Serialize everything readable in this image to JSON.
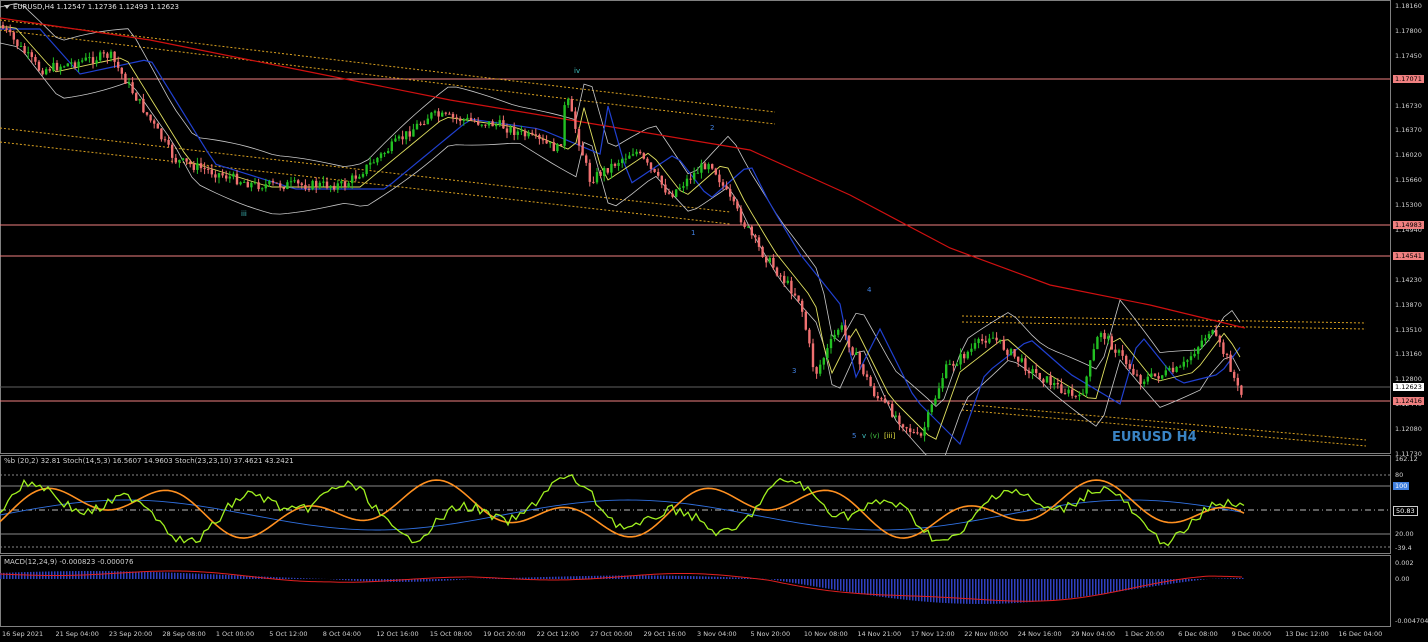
{
  "header": {
    "symbol": "EURUSD,H4",
    "ohlc": "1.12547 1.12736 1.12493 1.12623"
  },
  "watermark": "EURUSD H4",
  "price_axis": [
    "1.18160",
    "1.17800",
    "1.17450",
    "1.17090",
    "1.16730",
    "1.16370",
    "1.16020",
    "1.15660",
    "1.15300",
    "1.14940",
    "1.14580",
    "1.14230",
    "1.13870",
    "1.13510",
    "1.13160",
    "1.12800",
    "1.12440",
    "1.12080",
    "1.11730"
  ],
  "price_tags": [
    {
      "text": "1.17071",
      "bg": "#f08080",
      "fg": "#000"
    },
    {
      "text": "1.14983",
      "bg": "#f08080",
      "fg": "#000"
    },
    {
      "text": "1.14541",
      "bg": "#f08080",
      "fg": "#000"
    },
    {
      "text": "1.12623",
      "bg": "#ffffff",
      "fg": "#000"
    },
    {
      "text": "1.12416",
      "bg": "#f08080",
      "fg": "#000"
    }
  ],
  "waves": {
    "iii": "iii",
    "iv": "iv",
    "w1": "1",
    "w2": "2",
    "w3": "3",
    "w4": "4",
    "w5": "5",
    "v": "v",
    "vp": "(v)",
    "iiib": "[iii]"
  },
  "stoch_header": "%b (20,2) 32.81  Stoch(14,5,3) 16.5607 14.9603  Stoch(23,23,10) 37.4621 43.2421",
  "stoch_axis": {
    "top": "162.12",
    "l80": "80",
    "l100": "100",
    "cur": "50.83",
    "l20": "20.00",
    "bottom": "-39.4"
  },
  "macd_header": "MACD(12,24,9) -0.000823 -0.000076",
  "macd_axis": {
    "top": "0.002",
    "mid": "0.00",
    "bottom": "-0.004704"
  },
  "time_axis": [
    "16 Sep 2021",
    "21 Sep 04:00",
    "23 Sep 20:00",
    "28 Sep 08:00",
    "1 Oct 00:00",
    "5 Oct 12:00",
    "8 Oct 04:00",
    "12 Oct 16:00",
    "15 Oct 08:00",
    "19 Oct 20:00",
    "22 Oct 12:00",
    "27 Oct 00:00",
    "29 Oct 16:00",
    "3 Nov 04:00",
    "5 Nov 20:00",
    "10 Nov 08:00",
    "14 Nov 21:00",
    "17 Nov 12:00",
    "22 Nov 00:00",
    "24 Nov 16:00",
    "29 Nov 04:00",
    "1 Dec 20:00",
    "6 Dec 08:00",
    "9 Dec 00:00",
    "13 Dec 12:00",
    "16 Dec 04:00"
  ],
  "colors": {
    "bull": "#22c022",
    "bear": "#f07070",
    "ma_red": "#d01010",
    "ma_blue": "#2040d0",
    "ma_yellow": "#e0e060",
    "band": "#c8c8c8",
    "channel": "#d8a020"
  }
}
